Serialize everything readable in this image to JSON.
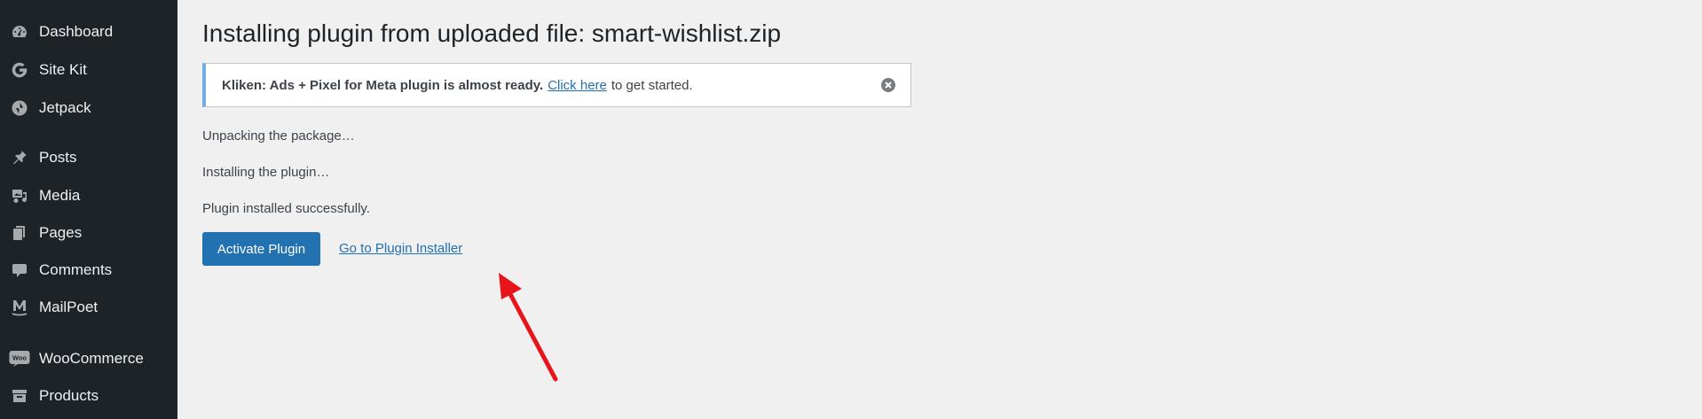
{
  "sidebar": {
    "items": [
      {
        "label": "Dashboard",
        "icon": "dashboard-icon"
      },
      {
        "label": "Site Kit",
        "icon": "google-g-icon"
      },
      {
        "label": "Jetpack",
        "icon": "jetpack-bolt-icon"
      },
      {
        "label": "Posts",
        "icon": "pushpin-icon"
      },
      {
        "label": "Media",
        "icon": "media-icon"
      },
      {
        "label": "Pages",
        "icon": "pages-icon"
      },
      {
        "label": "Comments",
        "icon": "comment-bubble-icon"
      },
      {
        "label": "MailPoet",
        "icon": "mailpoet-m-icon"
      },
      {
        "label": "WooCommerce",
        "icon": "woocommerce-woo-icon",
        "icon_text": "Woo"
      },
      {
        "label": "Products",
        "icon": "archive-box-icon"
      }
    ]
  },
  "main": {
    "title": "Installing plugin from uploaded file: smart-wishlist.zip",
    "notice": {
      "strong": "Kliken: Ads + Pixel for Meta plugin is almost ready.",
      "link": "Click here",
      "rest": "to get started.",
      "dismiss_icon": "dismiss-circle-x-icon"
    },
    "steps": [
      "Unpacking the package…",
      "Installing the plugin…",
      "Plugin installed successfully."
    ],
    "actions": {
      "activate_label": "Activate Plugin",
      "installer_link": "Go to Plugin Installer"
    }
  },
  "colors": {
    "sidebar_bg": "#1d2327",
    "page_bg": "#f0f0f1",
    "primary_button": "#2271b1",
    "notice_border": "#72aee6",
    "annotation_arrow": "#e8141b"
  }
}
